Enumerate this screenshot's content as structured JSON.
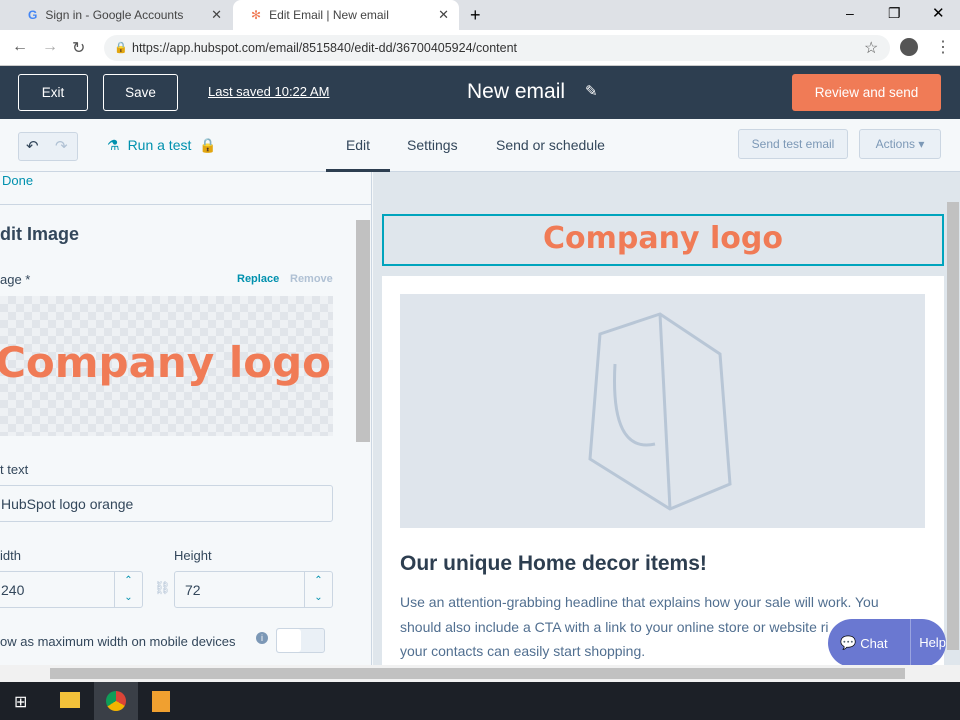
{
  "browser": {
    "tabs": [
      {
        "label": "Sign in - Google Accounts",
        "icon": "google-icon"
      },
      {
        "label": "Edit Email | New email",
        "icon": "hubspot-icon"
      }
    ],
    "url": "https://app.hubspot.com/email/8515840/edit-dd/36700405924/content"
  },
  "header": {
    "exit": "Exit",
    "save": "Save",
    "last_saved": "Last saved 10:22 AM",
    "title": "New email",
    "review": "Review and send"
  },
  "toolbar": {
    "run_test": "Run a test",
    "tabs": [
      "Edit",
      "Settings",
      "Send or schedule"
    ],
    "active_tab": "Edit",
    "send_test": "Send test email",
    "actions": "Actions ▾"
  },
  "panel": {
    "done": "Done",
    "title": "dit Image",
    "image_label": "age *",
    "replace": "Replace",
    "remove": "Remove",
    "preview_text": "Company logo",
    "alt_label": "t text",
    "alt_value": "HubSpot logo orange",
    "width_label": "idth",
    "width_value": "240",
    "height_label": "Height",
    "height_value": "72",
    "mobile_label": "ow as maximum width on mobile devices"
  },
  "preview": {
    "logo": "Company logo",
    "headline": "Our unique Home decor items!",
    "body": "Use an attention-grabbing headline that explains how your sale will work. You should also include a CTA with a link to your online store or website right so your contacts can easily start shopping.",
    "body_visible_1": "Use an attention-grabbing headline that explains how your sale will work. You",
    "body_visible_2": "should also include a CTA with a link to your online store or website ri",
    "body_visible_3": "your contacts can easily start shopping."
  },
  "chat": {
    "chat": "Chat",
    "help": "Help"
  },
  "colors": {
    "accent": "#f07b56",
    "dark": "#2d3e50",
    "link": "#0091ae"
  }
}
